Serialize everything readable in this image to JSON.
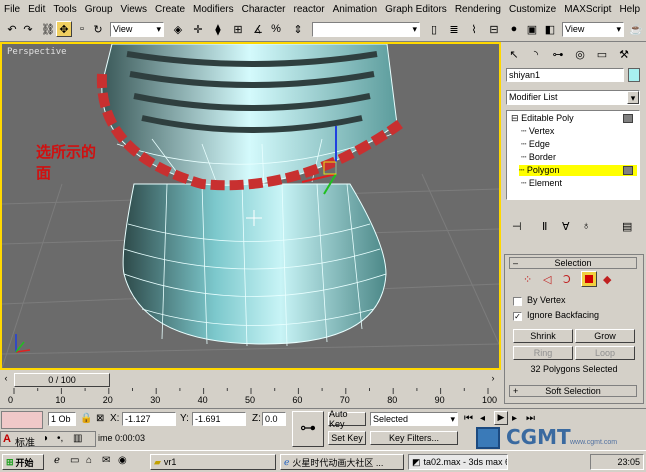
{
  "menu": [
    "File",
    "Edit",
    "Tools",
    "Group",
    "Views",
    "Create",
    "Modifiers",
    "Character",
    "reactor",
    "Animation",
    "Graph Editors",
    "Rendering",
    "Customize",
    "MAXScript",
    "Help"
  ],
  "toolbar": {
    "ref_coord": "View",
    "ref_coord2": "View"
  },
  "viewport": {
    "label": "Perspective",
    "annotation_line1": "选所示的",
    "annotation_line2": "面"
  },
  "panel": {
    "object_name": "shiyan1",
    "modifier_list": "Modifier List",
    "stack": {
      "root": "Editable Poly",
      "items": [
        "Vertex",
        "Edge",
        "Border",
        "Polygon",
        "Element"
      ],
      "selected": "Polygon"
    },
    "selection": {
      "title": "Selection",
      "by_vertex": "By Vertex",
      "ignore_backfacing": "Ignore Backfacing",
      "shrink": "Shrink",
      "grow": "Grow",
      "ring": "Ring",
      "loop": "Loop",
      "status": "32 Polygons Selected",
      "soft_selection": "Soft Selection"
    }
  },
  "timeline": {
    "frame": "0 / 100"
  },
  "ruler": {
    "ticks": [
      "0",
      "10",
      "20",
      "30",
      "40",
      "50",
      "60",
      "70",
      "80",
      "90",
      "100"
    ]
  },
  "status": {
    "objects": "1 Ob",
    "x_label": "X:",
    "x_value": "-1.127",
    "y_label": "Y:",
    "y_value": "-1.691",
    "z_label": "Z:",
    "z_value": "0.0",
    "autokey": "Auto Key",
    "setkey": "Set Key",
    "selected": "Selected",
    "key_filters": "Key Filters...",
    "time": "ime  0:00:03",
    "ime_label": "标准"
  },
  "taskbar": {
    "start": "开始",
    "items": [
      "vr1",
      "火星时代动画大社区 ...",
      "ta02.max - 3ds max 6 -"
    ],
    "clock": "23:05"
  },
  "watermark": {
    "text": "CGMT",
    "url": "www.cgmt.com"
  },
  "colors": {
    "viewport_bg": "#6b6b6b",
    "active_border": "#ffd800",
    "selected_faces": "#c83030",
    "mesh": "#a8e8ec",
    "annotation": "#d01010"
  }
}
